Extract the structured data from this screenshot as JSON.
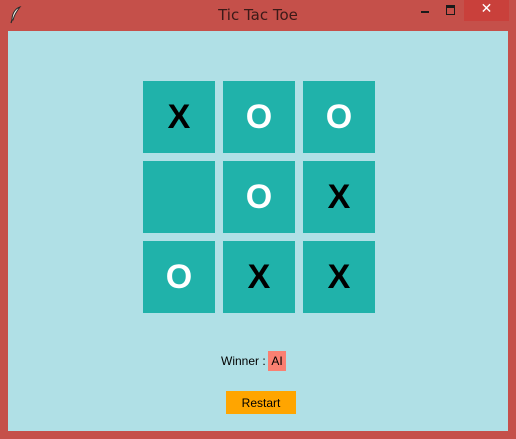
{
  "window": {
    "title": "Tic Tac Toe",
    "close_glyph": "✕",
    "colors": {
      "frame": "#c5504a",
      "client": "#b0e0e6"
    }
  },
  "board": {
    "cells": [
      [
        "X",
        "O",
        "O"
      ],
      [
        "",
        "O",
        "X"
      ],
      [
        "O",
        "X",
        "X"
      ]
    ],
    "colors": {
      "cell": "#20b2aa",
      "x_mark": "#000000",
      "o_mark": "#ffffff"
    }
  },
  "status": {
    "winner_label": "Winner :",
    "winner_value": "AI",
    "winner_color": "#fa8072"
  },
  "controls": {
    "restart_label": "Restart",
    "restart_color": "#ffa500"
  },
  "icons": {
    "app": "feather-icon",
    "minimize": "minimize-icon",
    "maximize": "maximize-icon",
    "close": "close-icon"
  }
}
